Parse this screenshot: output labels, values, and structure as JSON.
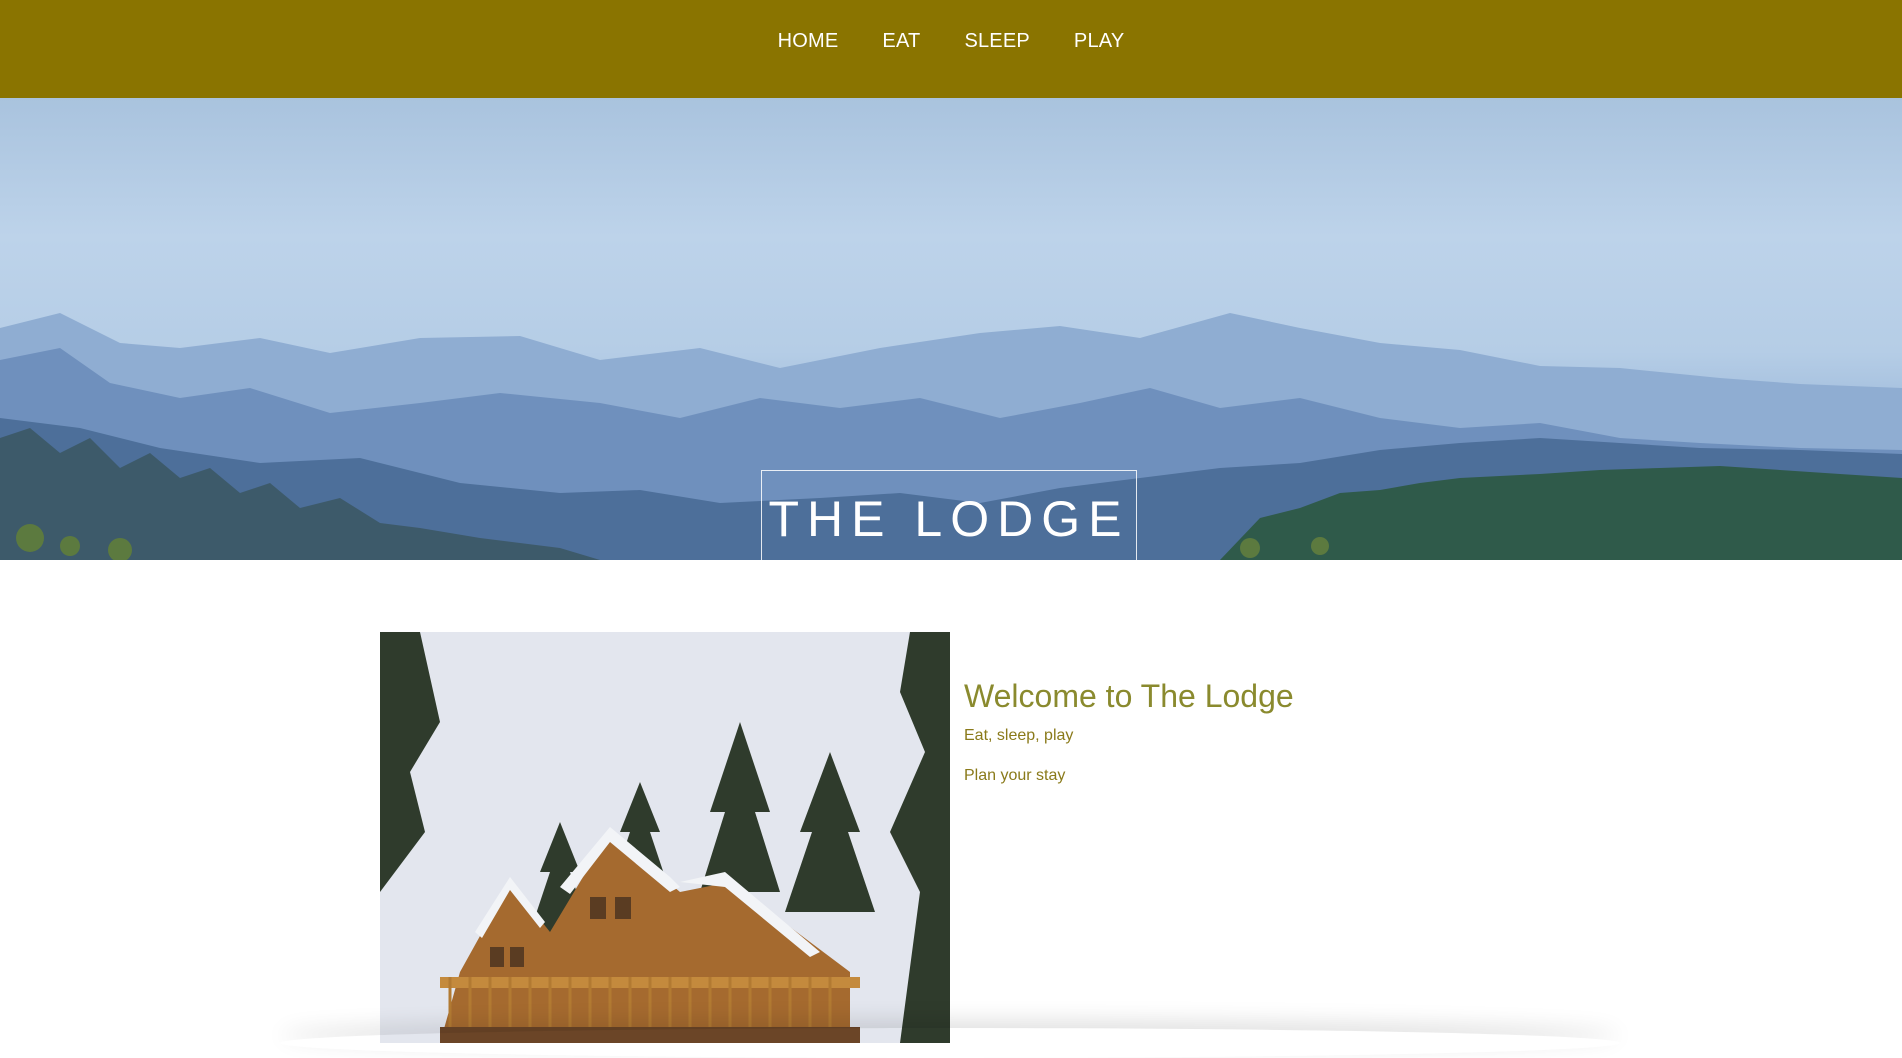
{
  "nav": {
    "items": [
      {
        "label": "HOME"
      },
      {
        "label": "EAT"
      },
      {
        "label": "SLEEP"
      },
      {
        "label": "PLAY"
      }
    ]
  },
  "hero": {
    "title": "THE LODGE"
  },
  "welcome": {
    "title": "Welcome to The Lodge",
    "subtitle": "Eat, sleep, play",
    "link": "Plan your stay"
  },
  "colors": {
    "navbar": "#8a7400",
    "heading": "#8a8a2e",
    "body_text": "#8a7a1a"
  }
}
